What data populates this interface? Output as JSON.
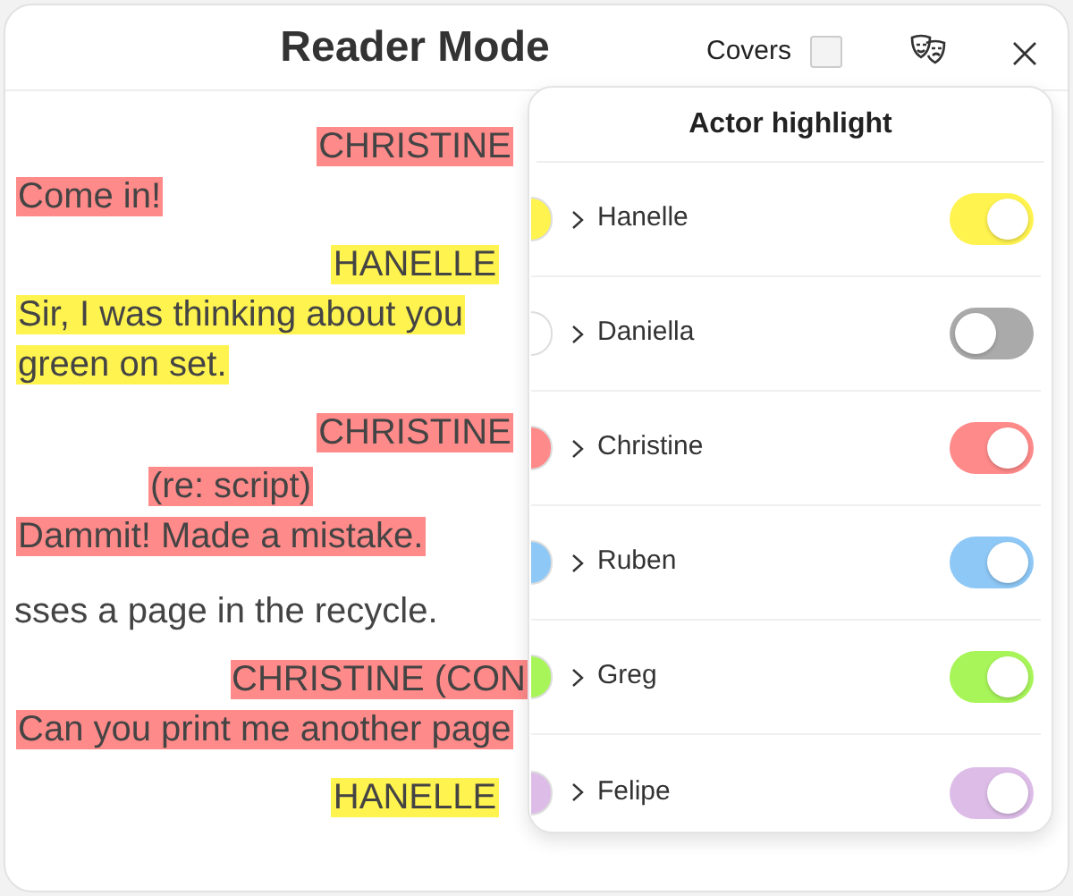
{
  "window": {
    "title": "Reader Mode"
  },
  "covers": {
    "label": "Covers",
    "checked": false
  },
  "script": [
    {
      "kind": "character",
      "text": "CHRISTINE",
      "color": "#ff8a8a"
    },
    {
      "kind": "dialogue",
      "text": "Come in!",
      "color": "#ff8a8a"
    },
    {
      "kind": "character",
      "text": "HANELLE",
      "color": "#fff350"
    },
    {
      "kind": "dialogue",
      "text": "Sir, I was thinking about you",
      "color": "#fff350"
    },
    {
      "kind": "dialogue",
      "text": "green on set.",
      "color": "#fff350"
    },
    {
      "kind": "character",
      "text": "CHRISTINE",
      "color": "#ff8a8a"
    },
    {
      "kind": "parenthetical",
      "text": "(re: script)",
      "color": "#ff8a8a"
    },
    {
      "kind": "dialogue",
      "text": "Dammit! Made a mistake.",
      "color": "#ff8a8a"
    },
    {
      "kind": "action",
      "text": "sses a page in the recycle."
    },
    {
      "kind": "character_cut",
      "text": "CHRISTINE (CON",
      "color": "#ff8a8a"
    },
    {
      "kind": "dialogue",
      "text": "Can you print me another page",
      "color": "#ff8a8a"
    },
    {
      "kind": "character",
      "text": "HANELLE",
      "color": "#fff350"
    }
  ],
  "popover": {
    "title": "Actor highlight"
  },
  "actors": [
    {
      "name": "Hanelle",
      "color": "#fff350",
      "on": true
    },
    {
      "name": "Daniella",
      "color": "#ffffff",
      "on": false
    },
    {
      "name": "Christine",
      "color": "#ff8a8a",
      "on": true
    },
    {
      "name": "Ruben",
      "color": "#8ec8f6",
      "on": true
    },
    {
      "name": "Greg",
      "color": "#a8f55a",
      "on": true
    },
    {
      "name": "Felipe",
      "color": "#ddbde8",
      "on": true
    }
  ]
}
